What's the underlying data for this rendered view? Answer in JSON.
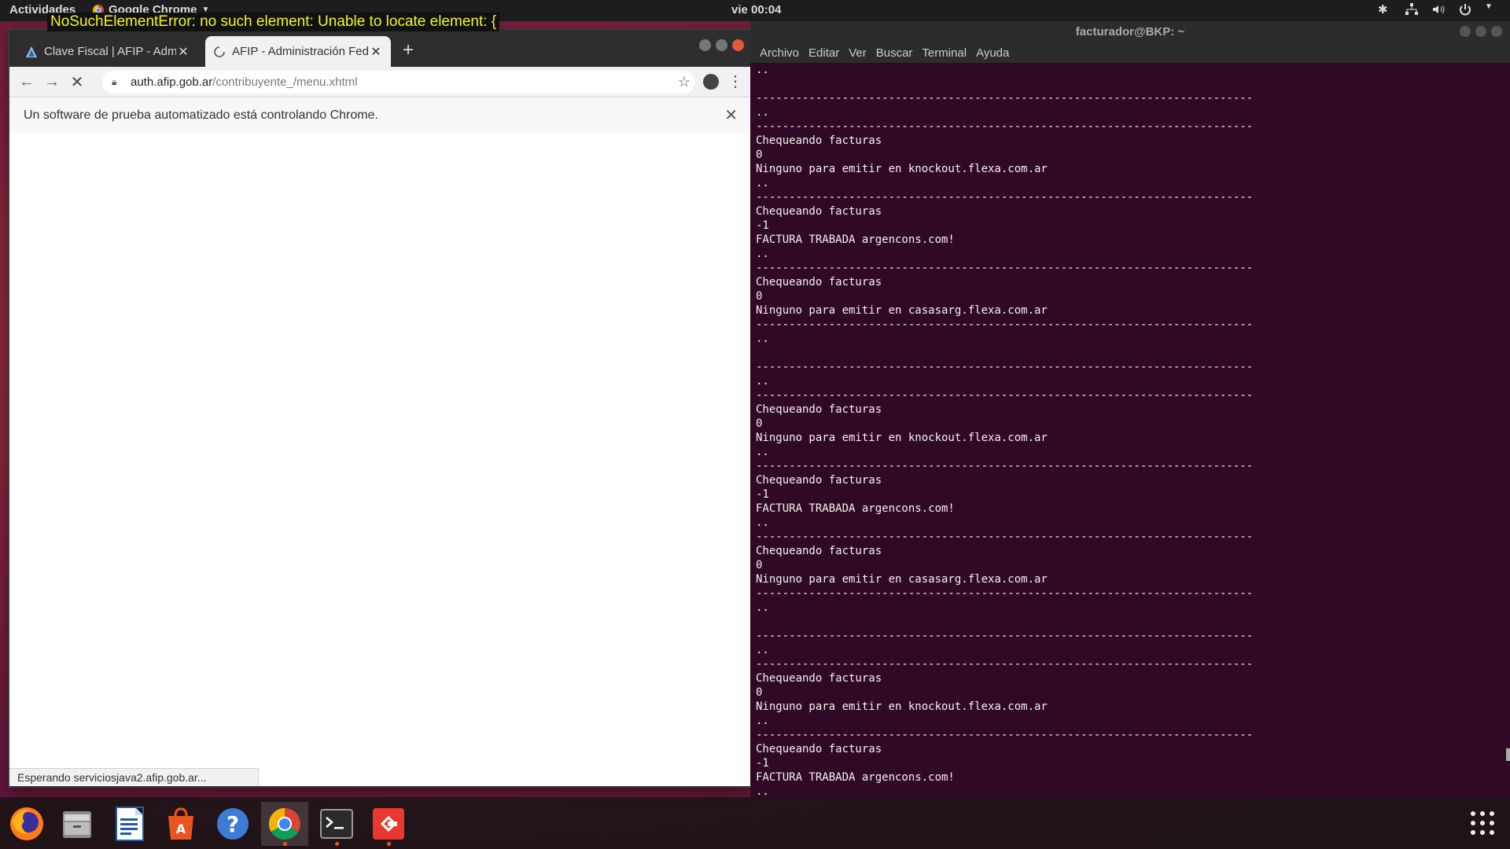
{
  "topbar": {
    "activities": "Actividades",
    "app_name": "Google Chrome",
    "clock": "vie 00:04"
  },
  "error_overlay": "NoSuchElementError: no such element: Unable to locate element: {",
  "chrome": {
    "tabs": [
      {
        "title": "Clave Fiscal | AFIP - Administración",
        "state": "inactive",
        "icon": "afip-icon"
      },
      {
        "title": "AFIP - Administración Federal",
        "state": "active",
        "icon": "loading-spinner-icon"
      }
    ],
    "url_host": "auth.afip.gob.ar",
    "url_path": "/contribuyente_/menu.xhtml",
    "infobar_message": "Un software de prueba automatizado está controlando Chrome.",
    "status_text": "Esperando serviciosjava2.afip.gob.ar..."
  },
  "terminal": {
    "title": "facturador@BKP: ~",
    "menu": [
      "Archivo",
      "Editar",
      "Ver",
      "Buscar",
      "Terminal",
      "Ayuda"
    ],
    "background": "#300a24",
    "output": "..\n\n---------------------------------------------------------------------------\n..\n---------------------------------------------------------------------------\nChequeando facturas\n0\nNinguno para emitir en knockout.flexa.com.ar\n..\n---------------------------------------------------------------------------\nChequeando facturas\n-1\nFACTURA TRABADA argencons.com!\n..\n---------------------------------------------------------------------------\nChequeando facturas\n0\nNinguno para emitir en casasarg.flexa.com.ar\n---------------------------------------------------------------------------\n..\n\n---------------------------------------------------------------------------\n..\n---------------------------------------------------------------------------\nChequeando facturas\n0\nNinguno para emitir en knockout.flexa.com.ar\n..\n---------------------------------------------------------------------------\nChequeando facturas\n-1\nFACTURA TRABADA argencons.com!\n..\n---------------------------------------------------------------------------\nChequeando facturas\n0\nNinguno para emitir en casasarg.flexa.com.ar\n---------------------------------------------------------------------------\n..\n\n---------------------------------------------------------------------------\n..\n---------------------------------------------------------------------------\nChequeando facturas\n0\nNinguno para emitir en knockout.flexa.com.ar\n..\n---------------------------------------------------------------------------\nChequeando facturas\n-1\nFACTURA TRABADA argencons.com!\n.."
  },
  "dock": {
    "items": [
      "firefox-icon",
      "files-icon",
      "writer-icon",
      "software-center-icon",
      "help-icon",
      "chrome-icon",
      "terminal-icon",
      "git-icon",
      "show-applications-icon"
    ],
    "accent": "#e95420"
  }
}
